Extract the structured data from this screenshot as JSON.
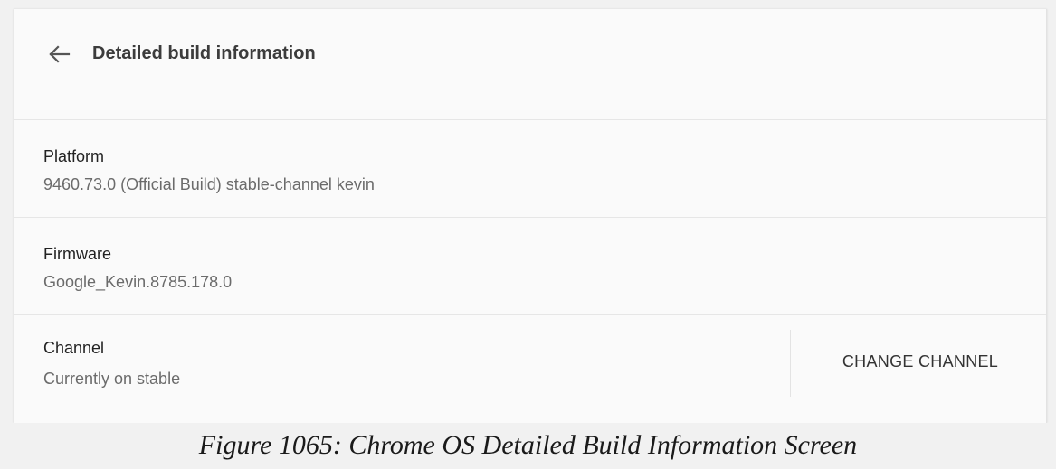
{
  "header": {
    "back_icon": "arrow-back-icon",
    "title": "Detailed build information"
  },
  "rows": [
    {
      "label": "Platform",
      "value": "9460.73.0 (Official Build) stable-channel kevin"
    },
    {
      "label": "Firmware",
      "value": "Google_Kevin.8785.178.0"
    },
    {
      "label": "Channel",
      "value": "Currently on stable",
      "action_label": "CHANGE CHANNEL"
    }
  ],
  "caption": "Figure 1065: Chrome OS Detailed Build Information Screen",
  "colors": {
    "background": "#f1f1f1",
    "panel": "#fafafa",
    "title": "#3c3c3c",
    "secondary_text": "#6b6b6b",
    "divider": "#e6e6e6"
  }
}
